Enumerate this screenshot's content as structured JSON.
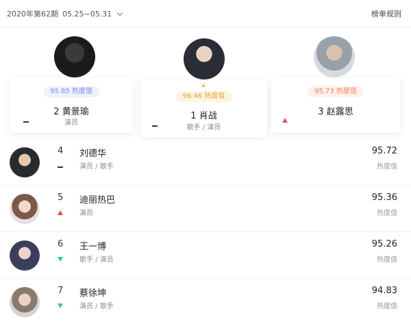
{
  "header": {
    "period": "2020年第62期",
    "date_range": "05.25~05.31",
    "rules_link": "榜单规则"
  },
  "podium": [
    {
      "rank": "2",
      "name": "黄景瑜",
      "score": "95.85",
      "score_unit": "热度值",
      "role": "演员",
      "trend": "flat"
    },
    {
      "rank": "1",
      "name": "肖战",
      "score": "96.46",
      "score_unit": "热度值",
      "role": "歌手 / 演员",
      "trend": "flat"
    },
    {
      "rank": "3",
      "name": "赵露思",
      "score": "95.73",
      "score_unit": "热度值",
      "role": "",
      "trend": "up"
    }
  ],
  "list": [
    {
      "rank": "4",
      "name": "刘德华",
      "role": "演员 / 歌手",
      "score": "95.72",
      "score_unit": "热度值",
      "trend": "flat"
    },
    {
      "rank": "5",
      "name": "迪丽热巴",
      "role": "演员",
      "score": "95.36",
      "score_unit": "热度值",
      "trend": "up"
    },
    {
      "rank": "6",
      "name": "王一博",
      "role": "歌手 / 演员",
      "score": "95.26",
      "score_unit": "热度值",
      "trend": "down"
    },
    {
      "rank": "7",
      "name": "蔡徐坤",
      "role": "演员 / 歌手",
      "score": "94.83",
      "score_unit": "热度值",
      "trend": "down"
    }
  ],
  "colors": {
    "trend_up": "#e84c4c",
    "trend_down": "#2fc2a8",
    "badge_gold": "#e0a43a"
  }
}
